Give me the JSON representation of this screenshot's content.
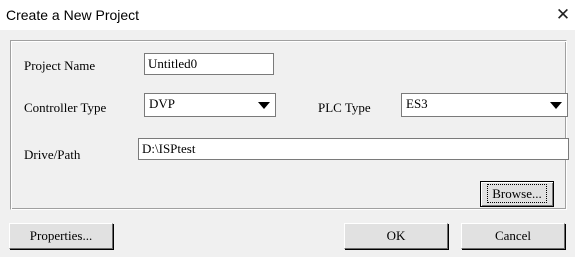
{
  "window": {
    "title": "Create a New Project",
    "close_glyph": "✕"
  },
  "form": {
    "project_name_label": "Project Name",
    "project_name_value": "Untitled0",
    "controller_type_label": "Controller Type",
    "controller_type_value": "DVP",
    "plc_type_label": "PLC Type",
    "plc_type_value": "ES3",
    "drive_path_label": "Drive/Path",
    "drive_path_value": "D:\\ISPtest"
  },
  "buttons": {
    "browse": "Browse...",
    "properties": "Properties...",
    "ok": "OK",
    "cancel": "Cancel"
  },
  "icons": {
    "close": "close-icon",
    "dropdown": "chevron-down-icon"
  }
}
